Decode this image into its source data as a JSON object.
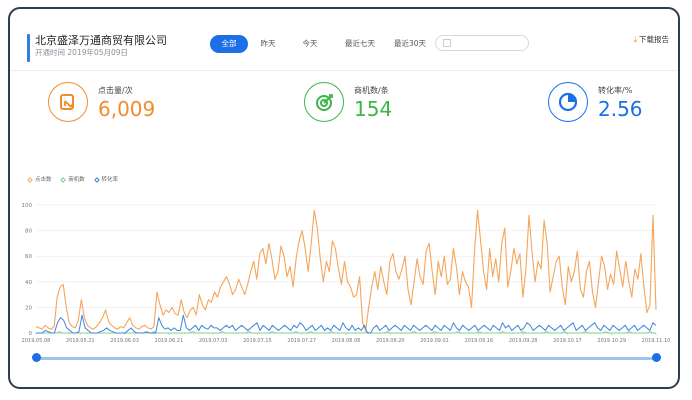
{
  "header": {
    "company_name": "北京盛泽万通商贸有限公司",
    "opened_label": "开通时间 2019年05月09日",
    "tabs": [
      {
        "label": "全部",
        "active": true
      },
      {
        "label": "昨天",
        "active": false
      },
      {
        "label": "今天",
        "active": false
      },
      {
        "label": "最近七天",
        "active": false
      },
      {
        "label": "最近30天",
        "active": false
      }
    ],
    "date_range_placeholder": "",
    "download_label": "下载报告",
    "download_icon": "download-icon"
  },
  "stats": [
    {
      "label": "点击量/次",
      "value": "6,009",
      "color": "#f08c2e",
      "icon": "click-report-icon"
    },
    {
      "label": "商机数/条",
      "value": "154",
      "color": "#3cb54a",
      "icon": "target-icon"
    },
    {
      "label": "转化率/%",
      "value": "2.56",
      "color": "#1d6fe5",
      "icon": "pie-icon"
    }
  ],
  "chart_data": {
    "type": "line",
    "title": "",
    "xlabel": "",
    "ylabel": "",
    "ylim": [
      0,
      100
    ],
    "yticks": [
      0,
      20,
      40,
      60,
      80,
      100
    ],
    "x_tick_labels": [
      "2019.05.08",
      "2019.05.21",
      "2019.06.03",
      "2019.06.21",
      "2019.07.03",
      "2019.07.15",
      "2019.07.27",
      "2019.08.08",
      "2019.08.20",
      "2019.09.01",
      "2019.09.16",
      "2019.09.28",
      "2019.10.17",
      "2019.10.29",
      "2019.11.10"
    ],
    "legend_position": "top-left",
    "series": [
      {
        "name": "点击数",
        "color": "#f5a55a",
        "values": [
          5,
          4,
          3,
          6,
          4,
          3,
          5,
          28,
          36,
          38,
          20,
          8,
          5,
          4,
          10,
          26,
          12,
          6,
          4,
          3,
          5,
          8,
          12,
          18,
          9,
          6,
          4,
          3,
          5,
          4,
          8,
          12,
          6,
          4,
          3,
          5,
          6,
          4,
          3,
          5,
          32,
          22,
          14,
          18,
          16,
          20,
          15,
          14,
          26,
          16,
          12,
          18,
          20,
          14,
          30,
          22,
          18,
          26,
          24,
          32,
          28,
          36,
          40,
          44,
          38,
          30,
          34,
          42,
          36,
          30,
          38,
          48,
          56,
          42,
          62,
          66,
          54,
          70,
          58,
          42,
          48,
          68,
          60,
          44,
          52,
          36,
          58,
          72,
          80,
          66,
          48,
          70,
          96,
          82,
          58,
          40,
          56,
          48,
          72,
          66,
          50,
          38,
          56,
          40,
          36,
          28,
          30,
          44,
          8,
          2,
          20,
          36,
          48,
          34,
          52,
          40,
          30,
          56,
          62,
          48,
          42,
          50,
          60,
          34,
          22,
          40,
          58,
          44,
          38,
          64,
          70,
          48,
          30,
          56,
          44,
          60,
          38,
          42,
          66,
          52,
          30,
          48,
          40,
          36,
          20,
          64,
          96,
          72,
          48,
          34,
          66,
          44,
          58,
          40,
          70,
          82,
          36,
          48,
          66,
          54,
          62,
          28,
          50,
          92,
          64,
          40,
          56,
          50,
          88,
          70,
          32,
          44,
          56,
          60,
          36,
          22,
          52,
          40,
          48,
          64,
          34,
          28,
          48,
          56,
          32,
          20,
          40,
          60,
          52,
          34,
          46,
          38,
          64,
          50,
          36,
          56,
          40,
          28,
          50,
          42,
          62,
          36,
          16,
          22,
          92,
          18
        ]
      },
      {
        "name": "商机数",
        "color": "#7fd08a",
        "values": [
          0,
          0,
          0,
          0,
          0,
          0,
          0,
          0,
          1,
          0,
          0,
          0,
          0,
          0,
          0,
          0,
          0,
          0,
          0,
          0,
          0,
          0,
          0,
          0,
          0,
          0,
          0,
          0,
          0,
          0,
          0,
          0,
          0,
          0,
          0,
          0,
          0,
          0,
          0,
          0,
          1,
          0,
          0,
          0,
          0,
          0,
          0,
          0,
          0,
          0,
          0,
          0,
          0,
          1,
          0,
          0,
          0,
          0,
          0,
          0,
          0,
          0,
          0,
          1,
          0,
          0,
          0,
          0,
          0,
          0,
          0,
          0,
          1,
          0,
          0,
          0,
          0,
          0,
          0,
          0,
          1,
          0,
          0,
          0,
          0,
          0,
          0,
          0,
          1,
          0,
          0,
          0,
          0,
          1,
          0,
          0,
          0,
          0,
          0,
          0,
          1,
          0,
          0,
          0,
          0,
          0,
          0,
          0,
          0,
          0,
          0,
          0,
          1,
          0,
          0,
          0,
          0,
          0,
          0,
          1,
          0,
          0,
          0,
          0,
          0,
          0,
          0,
          0,
          1,
          0,
          0,
          0,
          0,
          0,
          0,
          1,
          0,
          0,
          0,
          0,
          0,
          0,
          0,
          1,
          0,
          0,
          0,
          0,
          0,
          0,
          1,
          0,
          0,
          0,
          0,
          0,
          0,
          0,
          1,
          0,
          0,
          0,
          0,
          0,
          0,
          1,
          0,
          0,
          0,
          0,
          0,
          0,
          0,
          1,
          0,
          0,
          0,
          0,
          0,
          1,
          0,
          0,
          0,
          0,
          0,
          0,
          1,
          0,
          0,
          0,
          0,
          0,
          0,
          1,
          0,
          0,
          0,
          0,
          0,
          0,
          0,
          1,
          0,
          0,
          0,
          0,
          0,
          0,
          1,
          0,
          0
        ]
      },
      {
        "name": "转化率",
        "color": "#3d86e0",
        "values": [
          0,
          0,
          0,
          2,
          1,
          0,
          0,
          8,
          12,
          10,
          4,
          2,
          0,
          0,
          1,
          14,
          4,
          2,
          0,
          0,
          0,
          1,
          2,
          4,
          2,
          1,
          0,
          0,
          0,
          0,
          2,
          4,
          1,
          0,
          0,
          0,
          1,
          0,
          0,
          0,
          12,
          6,
          3,
          4,
          2,
          4,
          2,
          2,
          14,
          4,
          2,
          4,
          6,
          2,
          6,
          4,
          3,
          6,
          4,
          4,
          2,
          4,
          6,
          4,
          6,
          2,
          4,
          6,
          4,
          2,
          4,
          6,
          8,
          2,
          6,
          4,
          2,
          6,
          4,
          2,
          4,
          6,
          4,
          2,
          6,
          4,
          8,
          6,
          2,
          4,
          6,
          2,
          4,
          6,
          2,
          4,
          2,
          6,
          4,
          2,
          8,
          4,
          2,
          6,
          2,
          4,
          2,
          6,
          0,
          0,
          4,
          6,
          2,
          4,
          6,
          2,
          4,
          6,
          4,
          2,
          6,
          4,
          2,
          6,
          4,
          2,
          4,
          6,
          4,
          2,
          6,
          4,
          2,
          6,
          4,
          2,
          8,
          4,
          2,
          6,
          4,
          2,
          4,
          6,
          2,
          4,
          6,
          4,
          2,
          6,
          4,
          2,
          8,
          4,
          6,
          2,
          4,
          6,
          2,
          4,
          8,
          6,
          2,
          4,
          6,
          4,
          2,
          6,
          4,
          2,
          4,
          6,
          2,
          4,
          6,
          8,
          2,
          4,
          6,
          2,
          4,
          6,
          8,
          4,
          2,
          6,
          4,
          2,
          6,
          4,
          2,
          4,
          6,
          2,
          4,
          6,
          2,
          4,
          6,
          4,
          2,
          8,
          6
        ]
      }
    ]
  },
  "slider": {
    "start": 0,
    "end": 1
  }
}
